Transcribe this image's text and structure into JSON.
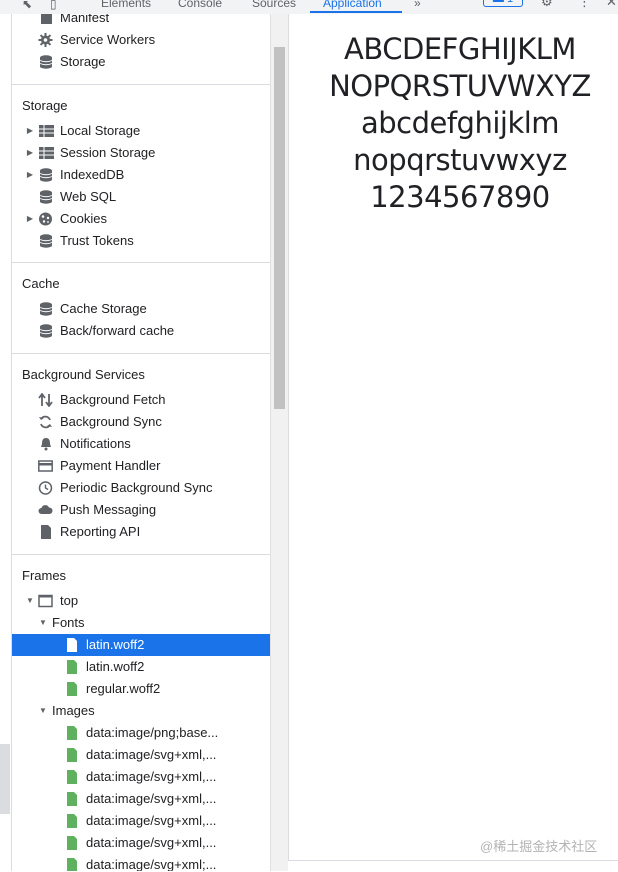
{
  "tabs": {
    "elements": "Elements",
    "console": "Console",
    "sources": "Sources",
    "application": "Application",
    "more": "»",
    "messages_count": "1"
  },
  "sidebar": {
    "application_items": [
      {
        "label": "Manifest",
        "icon": "document-icon"
      },
      {
        "label": "Service Workers",
        "icon": "gear-icon"
      },
      {
        "label": "Storage",
        "icon": "database-icon"
      }
    ],
    "storage": {
      "title": "Storage",
      "items": [
        {
          "label": "Local Storage",
          "icon": "table-icon",
          "expandable": true
        },
        {
          "label": "Session Storage",
          "icon": "table-icon",
          "expandable": true
        },
        {
          "label": "IndexedDB",
          "icon": "database-icon",
          "expandable": true
        },
        {
          "label": "Web SQL",
          "icon": "database-icon",
          "expandable": false
        },
        {
          "label": "Cookies",
          "icon": "cookie-icon",
          "expandable": true
        },
        {
          "label": "Trust Tokens",
          "icon": "database-icon",
          "expandable": false
        }
      ]
    },
    "cache": {
      "title": "Cache",
      "items": [
        {
          "label": "Cache Storage",
          "icon": "database-icon"
        },
        {
          "label": "Back/forward cache",
          "icon": "database-icon"
        }
      ]
    },
    "background_services": {
      "title": "Background Services",
      "items": [
        {
          "label": "Background Fetch",
          "icon": "up-down-arrows-icon"
        },
        {
          "label": "Background Sync",
          "icon": "sync-icon"
        },
        {
          "label": "Notifications",
          "icon": "bell-icon"
        },
        {
          "label": "Payment Handler",
          "icon": "card-icon"
        },
        {
          "label": "Periodic Background Sync",
          "icon": "clock-icon"
        },
        {
          "label": "Push Messaging",
          "icon": "cloud-icon"
        },
        {
          "label": "Reporting API",
          "icon": "document-icon"
        }
      ]
    },
    "frames": {
      "title": "Frames",
      "top_label": "top",
      "fonts_label": "Fonts",
      "fonts": [
        "latin.woff2",
        "latin.woff2",
        "regular.woff2"
      ],
      "selected_font_index": 0,
      "images_label": "Images",
      "images": [
        "data:image/png;base...",
        "data:image/svg+xml,...",
        "data:image/svg+xml,...",
        "data:image/svg+xml,...",
        "data:image/svg+xml,...",
        "data:image/svg+xml,...",
        "data:image/svg+xml;..."
      ]
    }
  },
  "preview": {
    "lines": [
      "ABCDEFGHIJKLM",
      "NOPQRSTUVWXYZ",
      "abcdefghijklm",
      "nopqrstuvwxyz",
      "1234567890"
    ]
  },
  "watermark": "@稀土掘金技术社区",
  "colors": {
    "selection": "#1a73e8",
    "file_icon_green": "#5fb15f",
    "icon_gray": "#5f6368"
  }
}
